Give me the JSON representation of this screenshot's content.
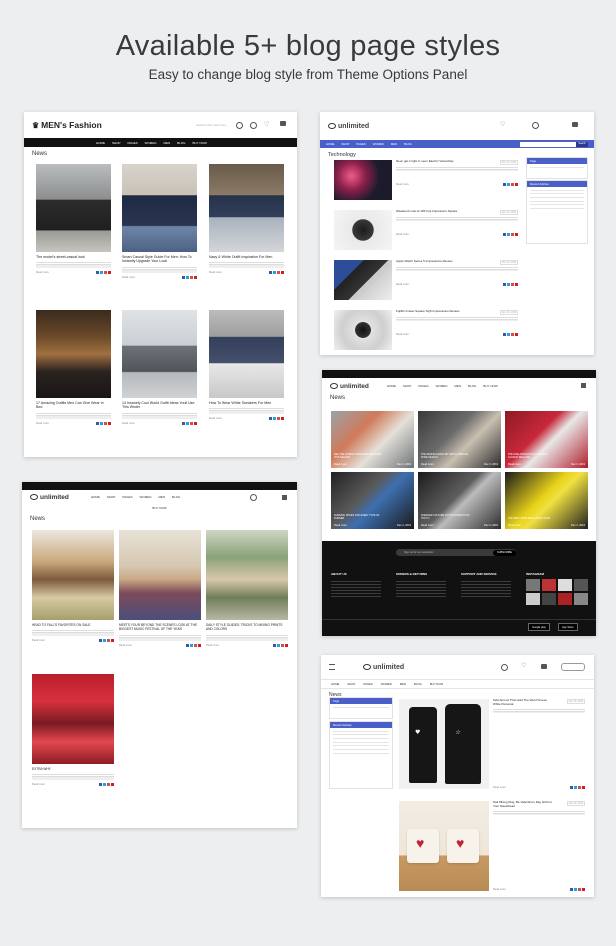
{
  "header": {
    "title": "Available 5+ blog page styles",
    "subtitle": "Easy to change blog style from Theme Options Panel"
  },
  "colors": {
    "accent_blue": "#4b5fc8",
    "accent_orange": "#f07d2a",
    "dark": "#111111",
    "background": "#eceeef"
  },
  "card1": {
    "logo": "MEN's Fashion",
    "search_placeholder": "Search entire store here...",
    "nav": [
      "HOME",
      "SHOP",
      "PAGES",
      "WOMEN",
      "MEN",
      "BLOG",
      "BUY NOW"
    ],
    "section_title": "News",
    "read_more": "Read more",
    "posts": [
      {
        "title": "The model's street-casual look",
        "date": "Dec 2, 2019"
      },
      {
        "title": "Smart Casual Style Guide For Men: How To Instantly Upgrade Your Look",
        "date": "Dec 2, 2019"
      },
      {
        "title": "Navy & White Outfit Inspiration For Men",
        "date": "Dec 2, 2019"
      },
      {
        "title": "17 Amazing Outfits Men Can Give Wear In Bed",
        "date": "Dec 2, 2019"
      },
      {
        "title": "14 Insanely Cool World Outfit Ideas Youll Use This Winter",
        "date": "Dec 2, 2019"
      },
      {
        "title": "How To Wear White Sneakers For Men",
        "date": "Dec 2, 2019"
      }
    ]
  },
  "card2": {
    "logo": "unlimited",
    "section_title": "Technology",
    "search_button": "Search",
    "read_more": "Read more",
    "posts": [
      {
        "title": "Neon get it right in neon Electric Visual Day",
        "date": "Dec 16, 2019"
      },
      {
        "title": "Weekend Look At 18X Fuji Impression Square",
        "date": "Dec 16, 2019"
      },
      {
        "title": "Apple Watch Series 5 Impressions Review",
        "date": "Dec 16, 2019"
      },
      {
        "title": "Fujifilm Instax Square SQ6 Impressions Review",
        "date": "Dec 16, 2019"
      }
    ],
    "sidebar_heads": [
      "Tags",
      "Recent Articles"
    ]
  },
  "card3": {
    "logo": "unlimited",
    "nav": [
      "HOME",
      "SHOP",
      "PAGES",
      "WOMEN",
      "MEN",
      "BLOG",
      "BUY NOW"
    ],
    "section_title": "News",
    "tile_caption": "Read more",
    "tile_dates": [
      "Dec 2, 2019",
      "Dec 2, 2019",
      "Dec 2, 2019",
      "Dec 2, 2019",
      "Dec 2, 2019",
      "Dec 2, 2019"
    ],
    "tile_titles": [
      "SEE THE 10 BEST SNEAKERS RELEASED THIS SEASON",
      "THE NEW BALANCE 997 GETS A SPECIAL SHOE DESIGN",
      "THE NIKE AIR MAX 90 IS THE NEW CLASSIC RELEASE",
      "RUNNING SHOES FOR EVERY TYPE OF RUNNER",
      "SNEAKER CULTURE ON THE STREETS OF TOKYO",
      "THE BEST SHOE DEALS RIGHT NOW"
    ],
    "footer": {
      "newsletter_placeholder": "Sign up for our newsletter",
      "subscribe": "SUBSCRIBE",
      "cols": [
        "ABOUT US",
        "ORDERS & RETURNS",
        "SUPPORT AND SERVICE",
        "INSTAGRAM"
      ],
      "app_badges": [
        "Google play",
        "App Store"
      ]
    }
  },
  "card4": {
    "logo": "unlimited",
    "nav": [
      "HOME",
      "SHOP",
      "PAGES",
      "WOMEN",
      "MEN",
      "BLOG",
      "BUY NOW"
    ],
    "section_title": "News",
    "read_more": "Read more",
    "posts": [
      {
        "title": "HEAD TO FALL'S FAVORITES ON SALE"
      },
      {
        "title": "MEETS YOUR BEYOND THE SCENES LOOK AT THE BIGGEST MUSIC FESTIVAL OF THE YEAR"
      },
      {
        "title": "DAILY STYLE GUIDES: TRICKS TO MIXING PRINTS AND COLORS"
      },
      {
        "title": "EXTRA WHY"
      }
    ]
  },
  "card5": {
    "logo": "unlimited",
    "section_title": "News",
    "read_more": "Read more",
    "posts": [
      {
        "title": "Kids Aprons That Hold The Word Screen White Personal",
        "date": "Dec 16, 2019"
      },
      {
        "title": "Nail Mixing Mug, Be Valentine's Day Gift For Your Sweetheart",
        "date": "Dec 16, 2019"
      }
    ],
    "sidebar_heads": [
      "Tags",
      "Recent Articles"
    ]
  }
}
